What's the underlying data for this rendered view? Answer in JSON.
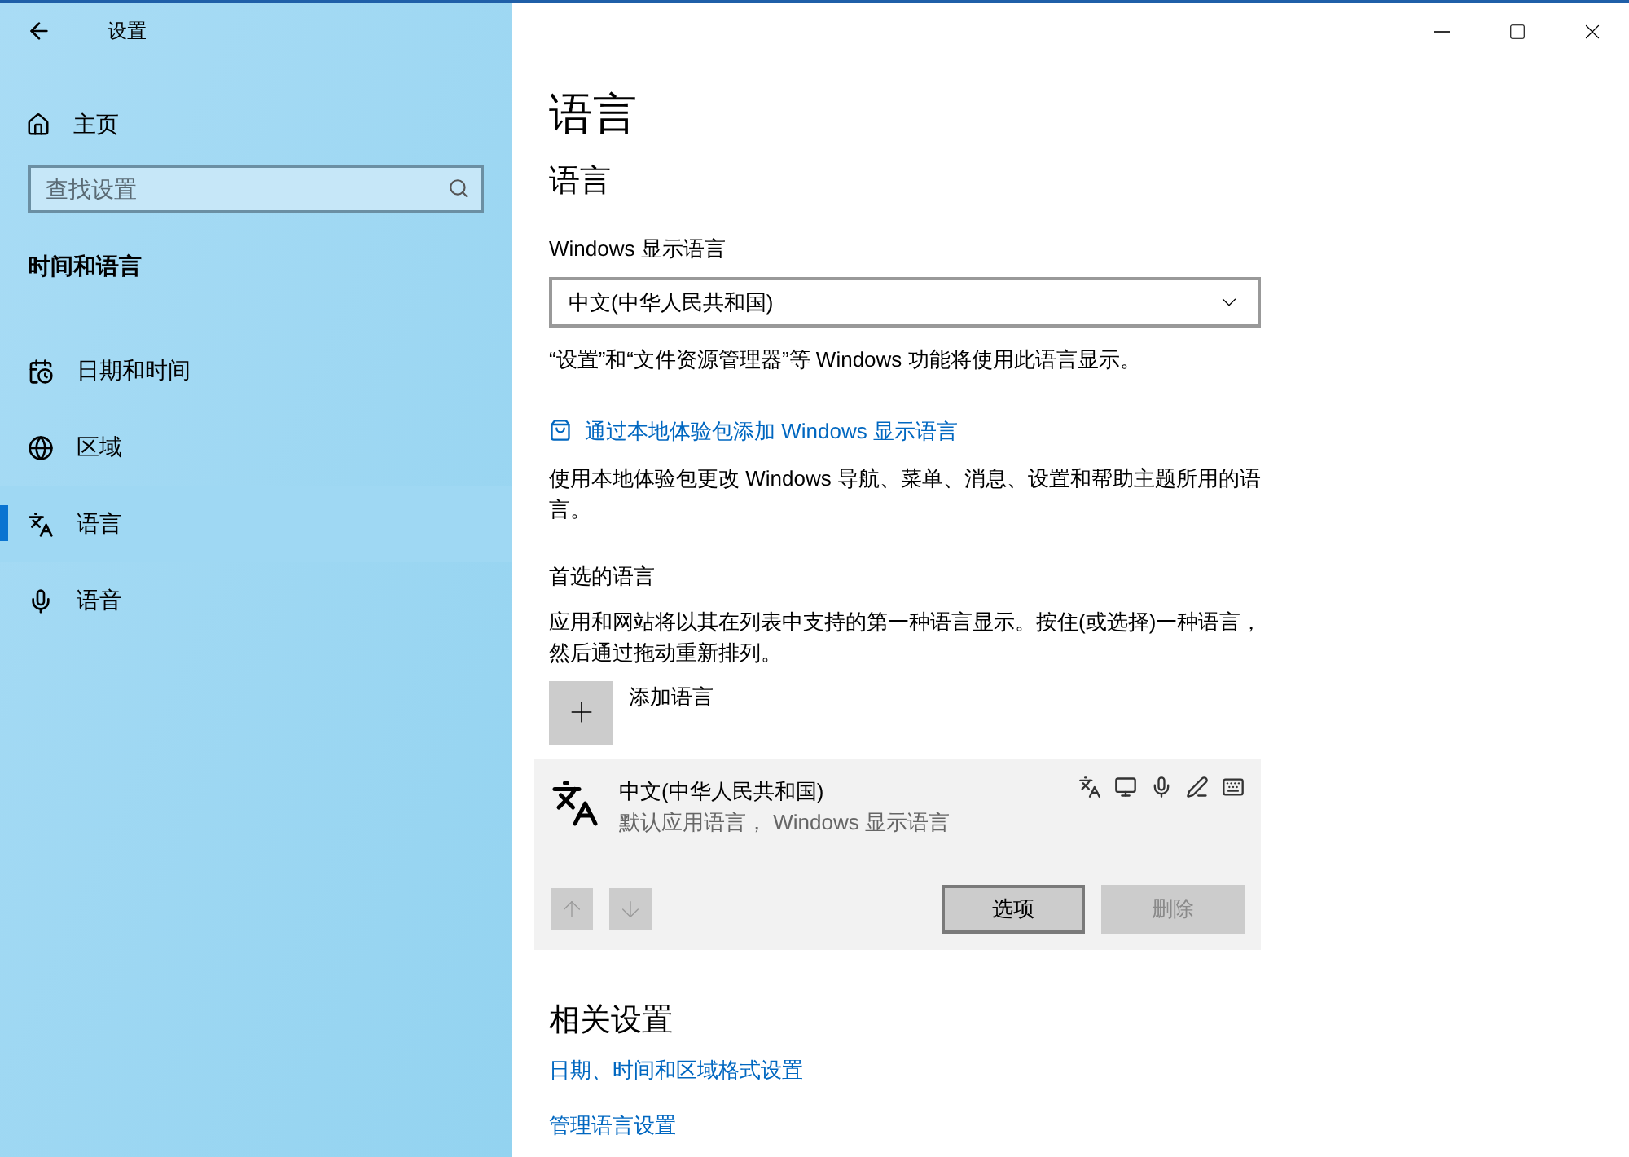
{
  "window": {
    "title": "设置"
  },
  "sidebar": {
    "home": "主页",
    "search": {
      "placeholder": "查找设置"
    },
    "section": "时间和语言",
    "items": [
      {
        "label": "日期和时间",
        "kind": "calendar",
        "selected": false
      },
      {
        "label": "区域",
        "kind": "globe",
        "selected": false
      },
      {
        "label": "语言",
        "kind": "language",
        "selected": true
      },
      {
        "label": "语音",
        "kind": "mic",
        "selected": false
      }
    ]
  },
  "content": {
    "title": "语言",
    "subtitle": "语言",
    "display_label": "Windows 显示语言",
    "display_value": "中文(中华人民共和国)",
    "display_note": "“设置”和“文件资源管理器”等 Windows 功能将使用此语言显示。",
    "store_link": "通过本地体验包添加 Windows 显示语言",
    "store_note": "使用本地体验包更改 Windows 导航、菜单、消息、设置和帮助主题所用的语言。",
    "preferred_title": "首选的语言",
    "preferred_note": "应用和网站将以其在列表中支持的第一种语言显示。按住(或选择)一种语言，然后通过拖动重新排列。",
    "add_language": "添加语言",
    "languages": [
      {
        "name": "中文(中华人民共和国)",
        "detail": "默认应用语言， Windows 显示语言",
        "expanded": true,
        "move_up_disabled": true,
        "move_down_disabled": true,
        "buttons": [
          {
            "label": "选项",
            "disabled": false
          },
          {
            "label": "删除",
            "disabled": true
          }
        ]
      }
    ],
    "related_title": "相关设置",
    "related_links": [
      "日期、时间和区域格式设置",
      "管理语言设置"
    ]
  }
}
